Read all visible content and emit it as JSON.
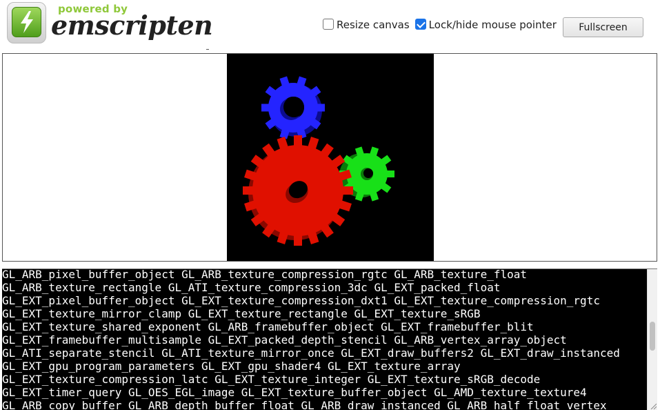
{
  "logo": {
    "powered_by": "powered by",
    "wordmark": "emscripten",
    "icon": "emscripten-lightning-icon"
  },
  "controls": {
    "resize_canvas": {
      "label": "Resize canvas",
      "checked": false
    },
    "lock_pointer": {
      "label": "Lock/hide mouse pointer",
      "checked": true
    },
    "fullscreen_label": "Fullscreen"
  },
  "scene": {
    "gears": [
      "red",
      "green",
      "blue"
    ],
    "colors": {
      "red": "#e01000",
      "green": "#10d010",
      "blue": "#2020ff",
      "background": "#000000"
    }
  },
  "console": {
    "lines": [
      "GL_ARB_pixel_buffer_object GL_ARB_texture_compression_rgtc GL_ARB_texture_float",
      "GL_ARB_texture_rectangle GL_ATI_texture_compression_3dc GL_EXT_packed_float",
      "GL_EXT_pixel_buffer_object GL_EXT_texture_compression_dxt1 GL_EXT_texture_compression_rgtc",
      "GL_EXT_texture_mirror_clamp GL_EXT_texture_rectangle GL_EXT_texture_sRGB",
      "GL_EXT_texture_shared_exponent GL_ARB_framebuffer_object GL_EXT_framebuffer_blit",
      "GL_EXT_framebuffer_multisample GL_EXT_packed_depth_stencil GL_ARB_vertex_array_object",
      "GL_ATI_separate_stencil GL_ATI_texture_mirror_once GL_EXT_draw_buffers2 GL_EXT_draw_instanced",
      "GL_EXT_gpu_program_parameters GL_EXT_gpu_shader4 GL_EXT_texture_array",
      "GL_EXT_texture_compression_latc GL_EXT_texture_integer GL_EXT_texture_sRGB_decode",
      "GL_EXT_timer_query GL_OES_EGL_image GL_EXT_texture_buffer_object GL_AMD_texture_texture4",
      "GL_ARB_copy_buffer GL_ARB_depth_buffer_float GL_ARB_draw_instanced GL_ARB_half_float_vertex"
    ]
  }
}
